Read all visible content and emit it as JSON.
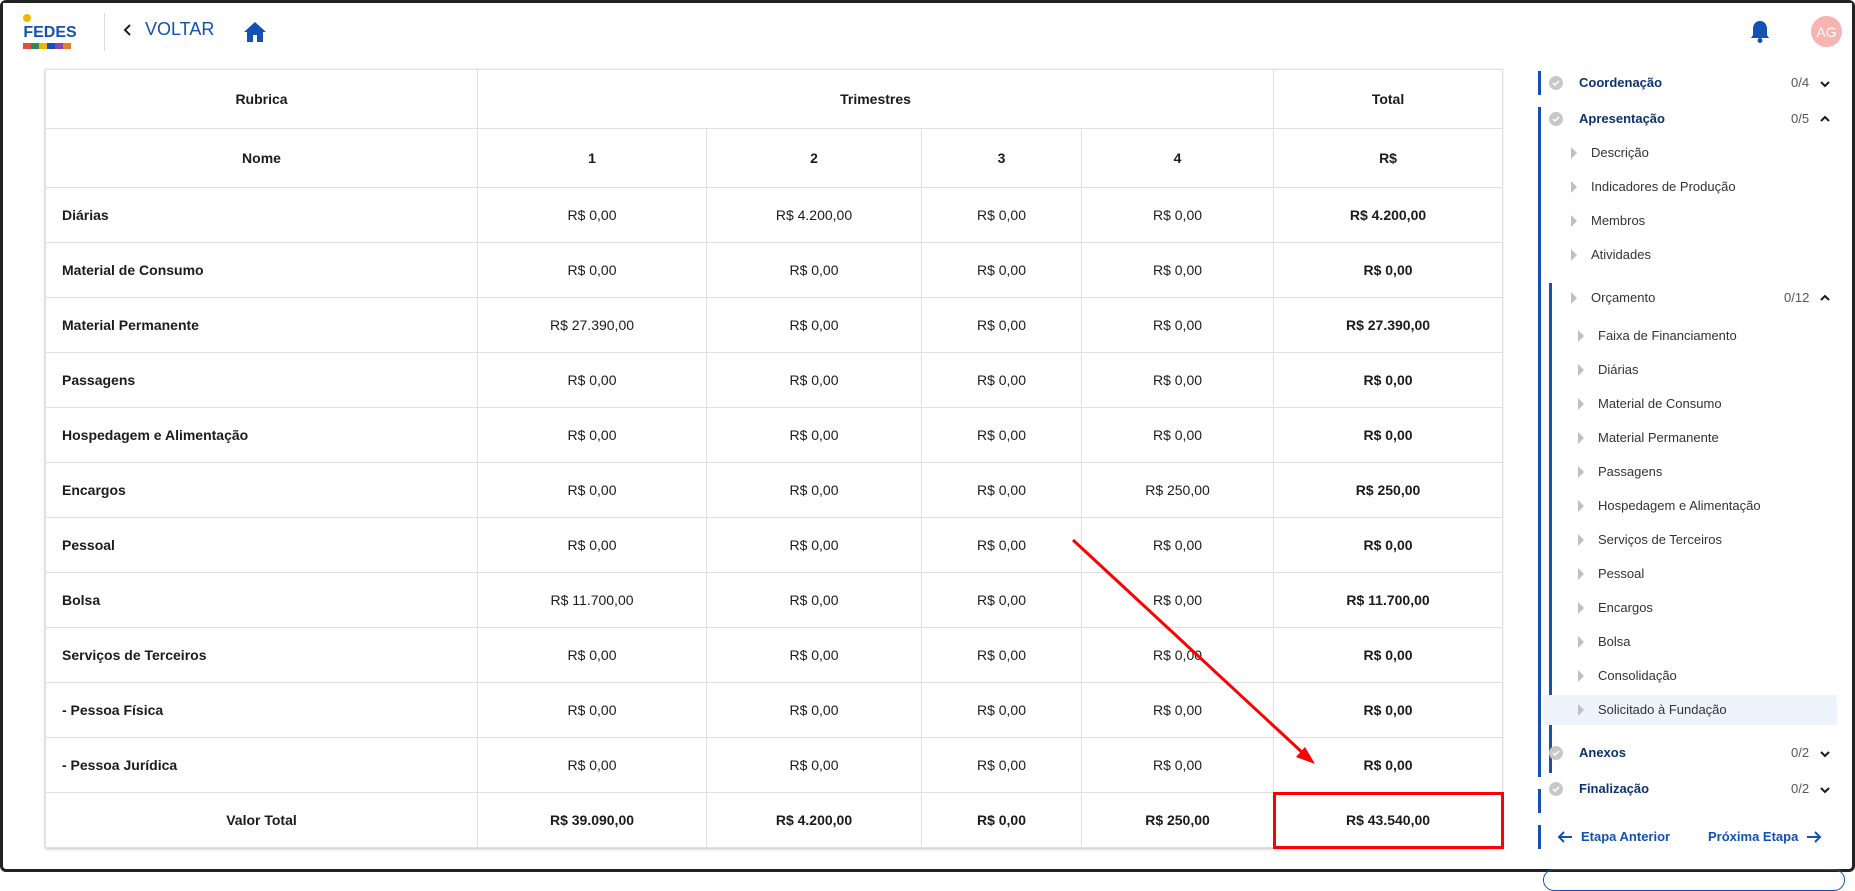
{
  "header": {
    "logo_text": "FEDES",
    "back_label": "VOLTAR",
    "avatar_initials": "AG"
  },
  "table": {
    "group_headers": [
      "Rubrica",
      "Trimestres",
      "Total"
    ],
    "sub_headers": [
      "Nome",
      "1",
      "2",
      "3",
      "4",
      "R$"
    ],
    "rows": [
      {
        "name": "Diárias",
        "q1": "R$ 0,00",
        "q2": "R$ 4.200,00",
        "q3": "R$ 0,00",
        "q4": "R$ 0,00",
        "total": "R$ 4.200,00"
      },
      {
        "name": "Material de Consumo",
        "q1": "R$ 0,00",
        "q2": "R$ 0,00",
        "q3": "R$ 0,00",
        "q4": "R$ 0,00",
        "total": "R$ 0,00"
      },
      {
        "name": "Material Permanente",
        "q1": "R$ 27.390,00",
        "q2": "R$ 0,00",
        "q3": "R$ 0,00",
        "q4": "R$ 0,00",
        "total": "R$ 27.390,00"
      },
      {
        "name": "Passagens",
        "q1": "R$ 0,00",
        "q2": "R$ 0,00",
        "q3": "R$ 0,00",
        "q4": "R$ 0,00",
        "total": "R$ 0,00"
      },
      {
        "name": "Hospedagem e Alimentação",
        "q1": "R$ 0,00",
        "q2": "R$ 0,00",
        "q3": "R$ 0,00",
        "q4": "R$ 0,00",
        "total": "R$ 0,00"
      },
      {
        "name": "Encargos",
        "q1": "R$ 0,00",
        "q2": "R$ 0,00",
        "q3": "R$ 0,00",
        "q4": "R$ 250,00",
        "total": "R$ 250,00"
      },
      {
        "name": "Pessoal",
        "q1": "R$ 0,00",
        "q2": "R$ 0,00",
        "q3": "R$ 0,00",
        "q4": "R$ 0,00",
        "total": "R$ 0,00"
      },
      {
        "name": "Bolsa",
        "q1": "R$ 11.700,00",
        "q2": "R$ 0,00",
        "q3": "R$ 0,00",
        "q4": "R$ 0,00",
        "total": "R$ 11.700,00"
      },
      {
        "name": "Serviços de Terceiros",
        "q1": "R$ 0,00",
        "q2": "R$ 0,00",
        "q3": "R$ 0,00",
        "q4": "R$ 0,00",
        "total": "R$ 0,00"
      },
      {
        "name": "- Pessoa Física",
        "q1": "R$ 0,00",
        "q2": "R$ 0,00",
        "q3": "R$ 0,00",
        "q4": "R$ 0,00",
        "total": "R$ 0,00"
      },
      {
        "name": "- Pessoa Jurídica",
        "q1": "R$ 0,00",
        "q2": "R$ 0,00",
        "q3": "R$ 0,00",
        "q4": "R$ 0,00",
        "total": "R$ 0,00"
      }
    ],
    "total_row": {
      "name": "Valor Total",
      "q1": "R$ 39.090,00",
      "q2": "R$ 4.200,00",
      "q3": "R$ 0,00",
      "q4": "R$ 250,00",
      "total": "R$ 43.540,00"
    }
  },
  "sidebar": {
    "sections": [
      {
        "label": "Coordenação",
        "count": "0/4"
      },
      {
        "label": "Apresentação",
        "count": "0/5"
      },
      {
        "label": "Anexos",
        "count": "0/2"
      },
      {
        "label": "Finalização",
        "count": "0/2"
      }
    ],
    "apresentacao_items": [
      "Descrição",
      "Indicadores de Produção",
      "Membros",
      "Atividades"
    ],
    "orcamento": {
      "label": "Orçamento",
      "count": "0/12"
    },
    "orcamento_items": [
      "Faixa de Financiamento",
      "Diárias",
      "Material de Consumo",
      "Material Permanente",
      "Passagens",
      "Hospedagem e Alimentação",
      "Serviços de Terceiros",
      "Pessoal",
      "Encargos",
      "Bolsa",
      "Consolidação",
      "Solicitado à Fundação"
    ],
    "prev_label": "Etapa Anterior",
    "next_label": "Próxima Etapa"
  },
  "colors": {
    "primary": "#1351b4",
    "highlight": "#ff0000"
  }
}
